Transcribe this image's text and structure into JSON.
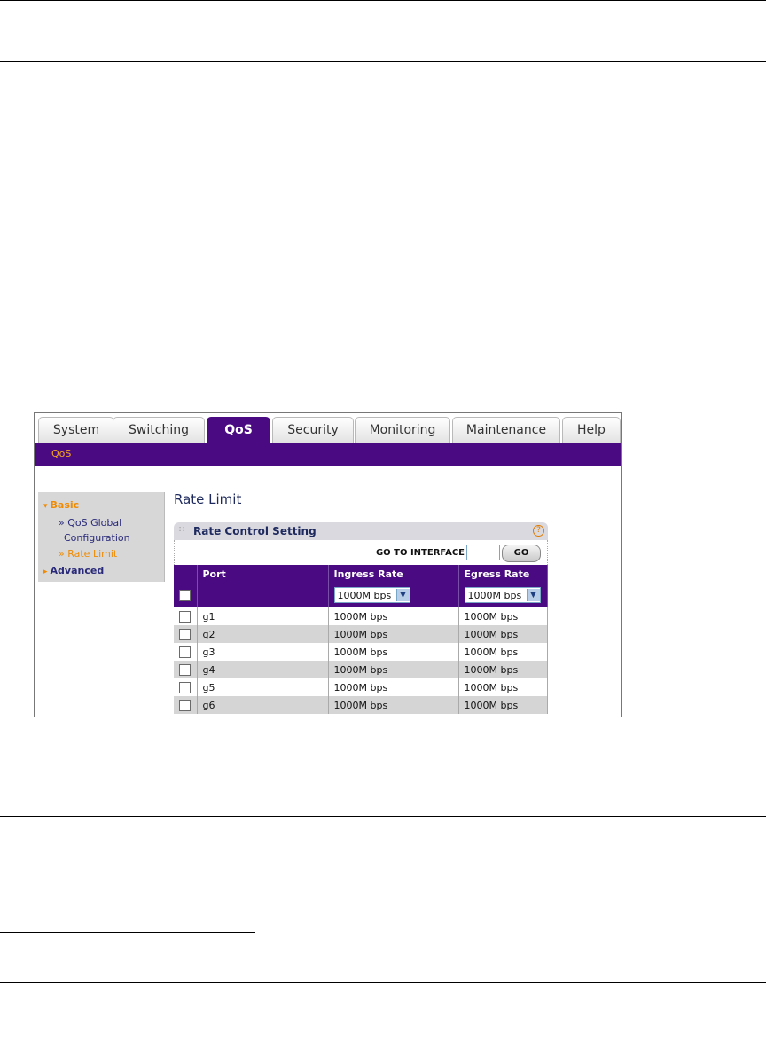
{
  "tabs": [
    {
      "label": "System"
    },
    {
      "label": "Switching"
    },
    {
      "label": "QoS",
      "active": true
    },
    {
      "label": "Security"
    },
    {
      "label": "Monitoring"
    },
    {
      "label": "Maintenance"
    },
    {
      "label": "Help"
    }
  ],
  "subnav": {
    "label": "QoS"
  },
  "sidebar": {
    "basic": "Basic",
    "items": [
      {
        "label": "» QoS Global"
      },
      {
        "label": "Configuration"
      },
      {
        "label": "» Rate Limit",
        "active": true
      }
    ],
    "advanced": "Advanced"
  },
  "page": {
    "title": "Rate Limit"
  },
  "panel": {
    "title": "Rate Control Setting",
    "help": "?",
    "goto_label": "GO TO INTERFACE",
    "goto_value": "",
    "go_button": "GO"
  },
  "table": {
    "headers": {
      "port": "Port",
      "ingress": "Ingress Rate",
      "egress": "Egress Rate"
    },
    "master": {
      "ingress": "1000M bps",
      "egress": "1000M bps"
    },
    "rows": [
      {
        "port": "g1",
        "ingress": "1000M bps",
        "egress": "1000M bps"
      },
      {
        "port": "g2",
        "ingress": "1000M bps",
        "egress": "1000M bps"
      },
      {
        "port": "g3",
        "ingress": "1000M bps",
        "egress": "1000M bps"
      },
      {
        "port": "g4",
        "ingress": "1000M bps",
        "egress": "1000M bps"
      },
      {
        "port": "g5",
        "ingress": "1000M bps",
        "egress": "1000M bps"
      },
      {
        "port": "g6",
        "ingress": "1000M bps",
        "egress": "1000M bps"
      }
    ]
  },
  "colors": {
    "brand_purple": "#4a0a82",
    "accent_orange": "#f08a00",
    "nav_blue": "#2a2a7a"
  }
}
